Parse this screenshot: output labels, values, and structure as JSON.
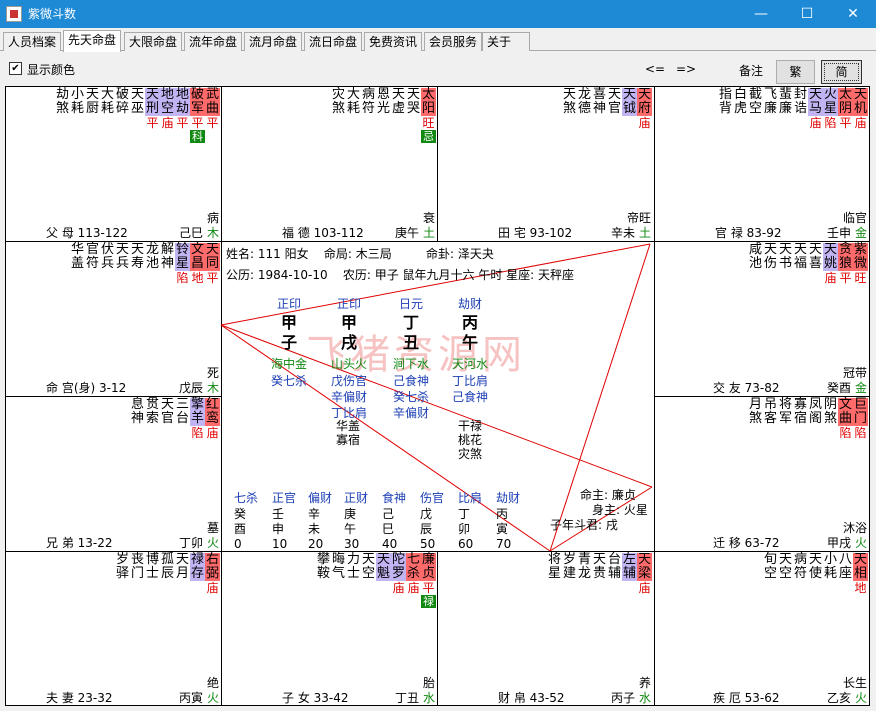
{
  "window": {
    "title": "紫微斗数",
    "min": "—",
    "max": "☐",
    "close": "✕"
  },
  "tabs": [
    "人员档案",
    "先天命盘",
    "大限命盘",
    "流年命盘",
    "流月命盘",
    "流日命盘",
    "免费资讯",
    "会员服务",
    "关于"
  ],
  "toolbar": {
    "show_color": "显示颜色",
    "prev": "<=",
    "next": "=>",
    "note": "备注",
    "fan": "繁",
    "jian": "简"
  },
  "palaces": [
    {
      "id": "fumu",
      "name": "父 母 113-122",
      "gz": "己巳",
      "state": "病",
      "el": "木",
      "stars": [
        {
          "n": "武曲",
          "bg": "r",
          "st": "平"
        },
        {
          "n": "破军",
          "bg": "r",
          "st": "平",
          "hua": "科"
        },
        {
          "n": "地劫",
          "bg": "p",
          "st": "平"
        },
        {
          "n": "地空",
          "bg": "p",
          "st": "庙"
        },
        {
          "n": "天刑",
          "bg": "p",
          "st": "平"
        },
        {
          "n": "天巫"
        },
        {
          "n": "破碎"
        },
        {
          "n": "大耗"
        },
        {
          "n": "天厨"
        },
        {
          "n": "小耗"
        },
        {
          "n": "劫煞"
        }
      ]
    },
    {
      "id": "fude",
      "name": "福 德 103-112",
      "gz": "庚午",
      "state": "衰",
      "el": "土",
      "stars": [
        {
          "n": "太阳",
          "bg": "r",
          "st": "旺",
          "hua": "忌"
        },
        {
          "n": "天哭"
        },
        {
          "n": "天虚"
        },
        {
          "n": "恩光"
        },
        {
          "n": "病符"
        },
        {
          "n": "大耗"
        },
        {
          "n": "灾煞"
        }
      ]
    },
    {
      "id": "tianzhai",
      "name": "田 宅 93-102",
      "gz": "辛未",
      "state": "帝旺",
      "el": "土",
      "stars": [
        {
          "n": "天府",
          "bg": "r",
          "st": "庙"
        },
        {
          "n": "天钺",
          "bg": "p"
        },
        {
          "n": "天官"
        },
        {
          "n": "喜神"
        },
        {
          "n": "龙德"
        },
        {
          "n": "天煞"
        }
      ]
    },
    {
      "id": "guanlu",
      "name": "官 禄 83-92",
      "gz": "壬申",
      "state": "临官",
      "el": "金",
      "stars": [
        {
          "n": "天机",
          "bg": "r",
          "st": "庙"
        },
        {
          "n": "太阴",
          "bg": "r",
          "st": "平"
        },
        {
          "n": "火星",
          "bg": "p",
          "st": "陷"
        },
        {
          "n": "天马",
          "bg": "p",
          "st": "庙"
        },
        {
          "n": "封诰"
        },
        {
          "n": "蜚廉"
        },
        {
          "n": "飞廉"
        },
        {
          "n": "截空"
        },
        {
          "n": "白虎"
        },
        {
          "n": "指背"
        }
      ]
    },
    {
      "id": "ming",
      "name": "命 宫(身) 3-12",
      "gz": "戊辰",
      "state": "死",
      "el": "木",
      "stars": [
        {
          "n": "天同",
          "bg": "r",
          "st": "平"
        },
        {
          "n": "文昌",
          "bg": "r",
          "st": "地"
        },
        {
          "n": "铃星",
          "bg": "p",
          "st": "陷"
        },
        {
          "n": "解神"
        },
        {
          "n": "龙池"
        },
        {
          "n": "天寿"
        },
        {
          "n": "天兵"
        },
        {
          "n": "伏兵"
        },
        {
          "n": "官符"
        },
        {
          "n": "华盖"
        }
      ]
    },
    {
      "id": "jiaoyou",
      "name": "交 友 73-82",
      "gz": "癸酉",
      "state": "冠带",
      "el": "金",
      "stars": [
        {
          "n": "紫微",
          "bg": "r",
          "st": "旺"
        },
        {
          "n": "贪狼",
          "bg": "r",
          "st": "平"
        },
        {
          "n": "天姚",
          "bg": "p",
          "st": "庙"
        },
        {
          "n": "天喜"
        },
        {
          "n": "天福"
        },
        {
          "n": "天书"
        },
        {
          "n": "天伤"
        },
        {
          "n": "咸池"
        }
      ]
    },
    {
      "id": "xiongdi",
      "name": "兄 弟 13-22",
      "gz": "丁卯",
      "state": "墓",
      "el": "火",
      "stars": [
        {
          "n": "红鸾",
          "bg": "r",
          "st": "庙"
        },
        {
          "n": "擎羊",
          "bg": "p",
          "st": "陷"
        },
        {
          "n": "三台"
        },
        {
          "n": "天官"
        },
        {
          "n": "贯索"
        },
        {
          "n": "息神"
        }
      ]
    },
    {
      "id": "qianyi",
      "name": "迁 移 63-72",
      "gz": "甲戌",
      "state": "沐浴",
      "el": "火",
      "stars": [
        {
          "n": "巨门",
          "bg": "r",
          "st": "陷"
        },
        {
          "n": "文曲",
          "bg": "r",
          "st": "陷"
        },
        {
          "n": "阴煞"
        },
        {
          "n": "凤阁"
        },
        {
          "n": "寡宿"
        },
        {
          "n": "将军"
        },
        {
          "n": "吊客"
        },
        {
          "n": "月煞"
        }
      ]
    },
    {
      "id": "fuqi",
      "name": "夫 妻 23-32",
      "gz": "丙寅",
      "state": "绝",
      "el": "火",
      "stars": [
        {
          "n": "右弼",
          "bg": "r",
          "st": "庙"
        },
        {
          "n": "禄存",
          "bg": "p"
        },
        {
          "n": "天月"
        },
        {
          "n": "孤辰"
        },
        {
          "n": "博士"
        },
        {
          "n": "丧门"
        },
        {
          "n": "岁驿"
        }
      ]
    },
    {
      "id": "zinv",
      "name": "子 女 33-42",
      "gz": "丁丑",
      "state": "胎",
      "el": "水",
      "stars": [
        {
          "n": "廉贞",
          "bg": "r",
          "st": "平",
          "hua": "禄"
        },
        {
          "n": "七杀",
          "bg": "r",
          "st": "庙"
        },
        {
          "n": "陀罗",
          "bg": "p",
          "st": "庙"
        },
        {
          "n": "天魁",
          "bg": "p"
        },
        {
          "n": "天空"
        },
        {
          "n": "力士"
        },
        {
          "n": "晦气"
        },
        {
          "n": "攀鞍"
        }
      ]
    },
    {
      "id": "caibo",
      "name": "财 帛 43-52",
      "gz": "丙子",
      "state": "养",
      "el": "水",
      "stars": [
        {
          "n": "天梁",
          "bg": "r",
          "st": "庙"
        },
        {
          "n": "左辅",
          "bg": "p"
        },
        {
          "n": "台辅"
        },
        {
          "n": "天贵"
        },
        {
          "n": "青龙"
        },
        {
          "n": "岁建"
        },
        {
          "n": "将星"
        }
      ]
    },
    {
      "id": "jie",
      "name": "疾 厄 53-62",
      "gz": "乙亥",
      "state": "长生",
      "el": "火",
      "stars": [
        {
          "n": "天相",
          "bg": "r",
          "st": "地"
        },
        {
          "n": "八座"
        },
        {
          "n": "小耗"
        },
        {
          "n": "天使"
        },
        {
          "n": "病符"
        },
        {
          "n": "天空"
        },
        {
          "n": "旬空"
        }
      ]
    }
  ],
  "center": {
    "line1": "姓名: 111 阳女    命局: 木三局         命卦: 泽天夬",
    "line2": "公历: 1984-10-10    农历: 甲子 鼠年九月十六 午时 星座: 天秤座",
    "pillars": [
      {
        "god": "正印",
        "stem": "甲",
        "branch": "子",
        "nayin": "海中金",
        "hidden": [
          "癸七杀"
        ]
      },
      {
        "god": "正印",
        "stem": "甲",
        "branch": "戌",
        "nayin": "山头火",
        "hidden": [
          "戊伤官",
          "辛偏财",
          "丁比肩"
        ]
      },
      {
        "god": "日元",
        "stem": "丁",
        "branch": "丑",
        "nayin": "涧下水",
        "hidden": [
          "己食神",
          "癸七杀",
          "辛偏财"
        ]
      },
      {
        "god": "劫财",
        "stem": "丙",
        "branch": "午",
        "nayin": "天河水",
        "hidden": [
          "丁比肩",
          "己食神"
        ]
      }
    ],
    "shensha_a": [
      "华盖",
      "寡宿"
    ],
    "shensha_b": [
      "干禄",
      "桃花",
      "灾煞"
    ],
    "mingzhu": "命主: 廉贞",
    "shenzhu": "身主: 火星",
    "doujun": "子年斗君: 戌",
    "dayun_gods": [
      "七杀",
      "正官",
      "偏财",
      "正财",
      "食神",
      "伤官",
      "比肩",
      "劫财"
    ],
    "dayun_stems": [
      "癸",
      "壬",
      "辛",
      "庚",
      "己",
      "戊",
      "丁",
      "丙"
    ],
    "dayun_branches": [
      "酉",
      "申",
      "未",
      "午",
      "巳",
      "辰",
      "卯",
      "寅"
    ],
    "dayun_ages": [
      "0",
      "10",
      "20",
      "30",
      "40",
      "50",
      "60",
      "70"
    ],
    "watermark": "飞猪资源网"
  }
}
